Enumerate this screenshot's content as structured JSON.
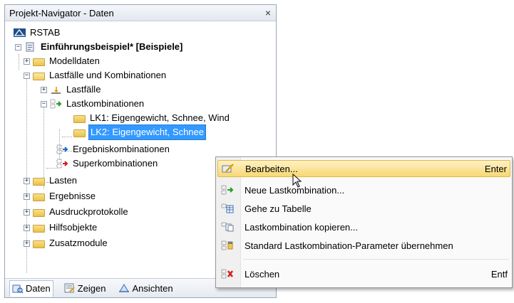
{
  "panel": {
    "title": "Projekt-Navigator - Daten",
    "close": "×"
  },
  "tree": {
    "root": "RSTAB",
    "project": "Einführungsbeispiel* [Beispiele]",
    "modelldaten": "Modelldaten",
    "lastfaelle_kombi": "Lastfälle und Kombinationen",
    "lastfaelle": "Lastfälle",
    "lastkombinationen": "Lastkombinationen",
    "lk1": "LK1: Eigengewicht, Schnee, Wind",
    "lk2": "LK2: Eigengewicht, Schnee",
    "ergebniskombinationen": "Ergebniskombinationen",
    "superkombinationen": "Superkombinationen",
    "lasten": "Lasten",
    "ergebnisse": "Ergebnisse",
    "ausdruckprotokolle": "Ausdruckprotokolle",
    "hilfsobjekte": "Hilfsobjekte",
    "zusatzmodule": "Zusatzmodule",
    "expand_plus": "+",
    "expand_minus": "−"
  },
  "tabs": {
    "daten": "Daten",
    "zeigen": "Zeigen",
    "ansichten": "Ansichten"
  },
  "menu": {
    "bearbeiten": "Bearbeiten...",
    "bearbeiten_shortcut": "Enter",
    "neue": "Neue Lastkombination...",
    "gehe": "Gehe zu Tabelle",
    "kopieren": "Lastkombination kopieren...",
    "standard": "Standard Lastkombination-Parameter übernehmen",
    "loeschen": "Löschen",
    "loeschen_shortcut": "Entf"
  },
  "colors": {
    "selection": "#3399ff",
    "menu_highlight": "#f8d872",
    "folder": "#e8c24a"
  }
}
